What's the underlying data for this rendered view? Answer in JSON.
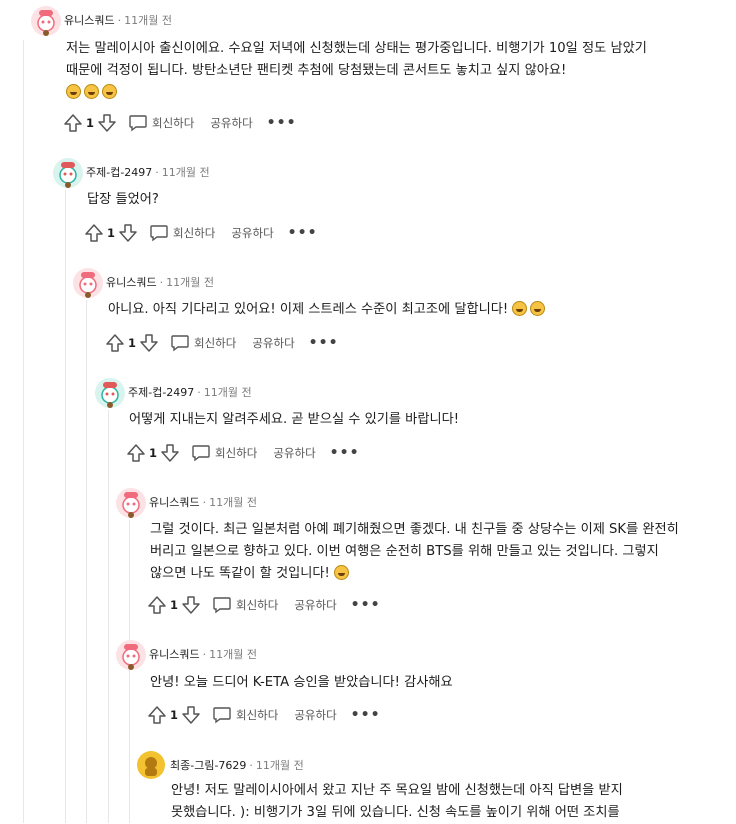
{
  "ui": {
    "dot": "·",
    "reply_label": "회신하다",
    "share_label": "공유하다",
    "more_label": "•••"
  },
  "comments": [
    {
      "author": "유니스쿼드",
      "time": "11개월 전",
      "text": "저는 말레이시아 출신이에요. 수요일 저녁에 신청했는데 상태는 평가중입니다. 비행기가 10일 정도 남았기 때문에 걱정이 됩니다. 방탄소년단 팬티켓 추첨에 당첨됐는데 콘서트도 놓치고 싶지 않아요!",
      "votes": "1",
      "avatar": "pink-snoo"
    },
    {
      "author": "주제-컵-2497",
      "time": "11개월 전",
      "text": "답장 들었어?",
      "votes": "1",
      "avatar": "teal-snoo"
    },
    {
      "author": "유니스쿼드",
      "time": "11개월 전",
      "text": "아니요. 아직 기다리고 있어요! 이제 스트레스 수준이 최고조에 달합니다!",
      "votes": "1",
      "avatar": "pink-snoo"
    },
    {
      "author": "주제-컵-2497",
      "time": "11개월 전",
      "text": "어떻게 지내는지 알려주세요. 곧 받으실 수 있기를 바랍니다!",
      "votes": "1",
      "avatar": "teal-snoo"
    },
    {
      "author": "유니스쿼드",
      "time": "11개월 전",
      "text": "그럴 것이다. 최근 일본처럼 아예 폐기해줬으면 좋겠다. 내 친구들 중 상당수는 이제 SK를 완전히 버리고 일본으로 향하고 있다. 이번 여행은 순전히 BTS를 위해 만들고 있는 것입니다. 그렇지 않으면 나도 똑같이 할 것입니다!",
      "votes": "1",
      "avatar": "pink-snoo"
    },
    {
      "author": "유니스쿼드",
      "time": "11개월 전",
      "text": "안녕! 오늘 드디어 K-ETA 승인을 받았습니다! 감사해요",
      "votes": "1",
      "avatar": "pink-snoo"
    },
    {
      "author": "최종-그림-7629",
      "time": "11개월 전",
      "text": "안녕! 저도 말레이시아에서 왔고 지난 주 목요일 밤에 신청했는데 아직 답변을 받지 못했습니다. ): 비행기가 3일 뒤에 있습니다. 신청 속도를 높이기 위해 어떤 조치를",
      "votes": "",
      "avatar": "yellow-avatar"
    }
  ],
  "colors": {
    "pink": "#f06b7b",
    "teal": "#2bb3a3",
    "yellow": "#f2c230"
  }
}
